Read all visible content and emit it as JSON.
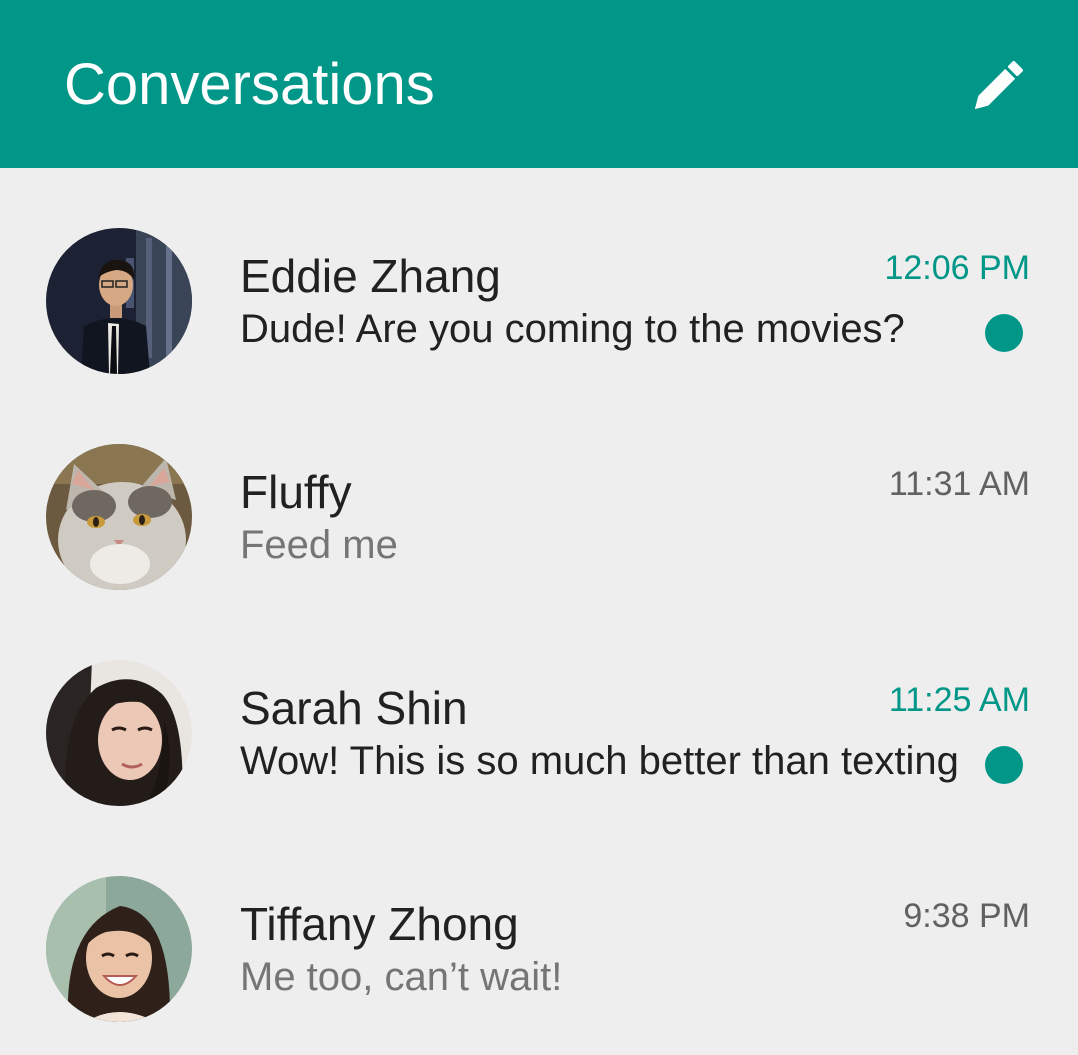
{
  "header": {
    "title": "Conversations",
    "compose_icon": "pencil-icon"
  },
  "colors": {
    "primary": "#009688",
    "background": "#eeeeee",
    "text_primary": "#212121",
    "text_secondary": "#757575"
  },
  "conversations": [
    {
      "name": "Eddie Zhang",
      "time": "12:06 PM",
      "preview": "Dude! Are you coming to the movies?",
      "unread": true
    },
    {
      "name": "Fluffy",
      "time": "11:31 AM",
      "preview": "Feed me",
      "unread": false
    },
    {
      "name": "Sarah Shin",
      "time": "11:25 AM",
      "preview": "Wow! This is so much better than texting",
      "unread": true
    },
    {
      "name": "Tiffany Zhong",
      "time": "9:38 PM",
      "preview": "Me too, can’t wait!",
      "unread": false
    }
  ]
}
